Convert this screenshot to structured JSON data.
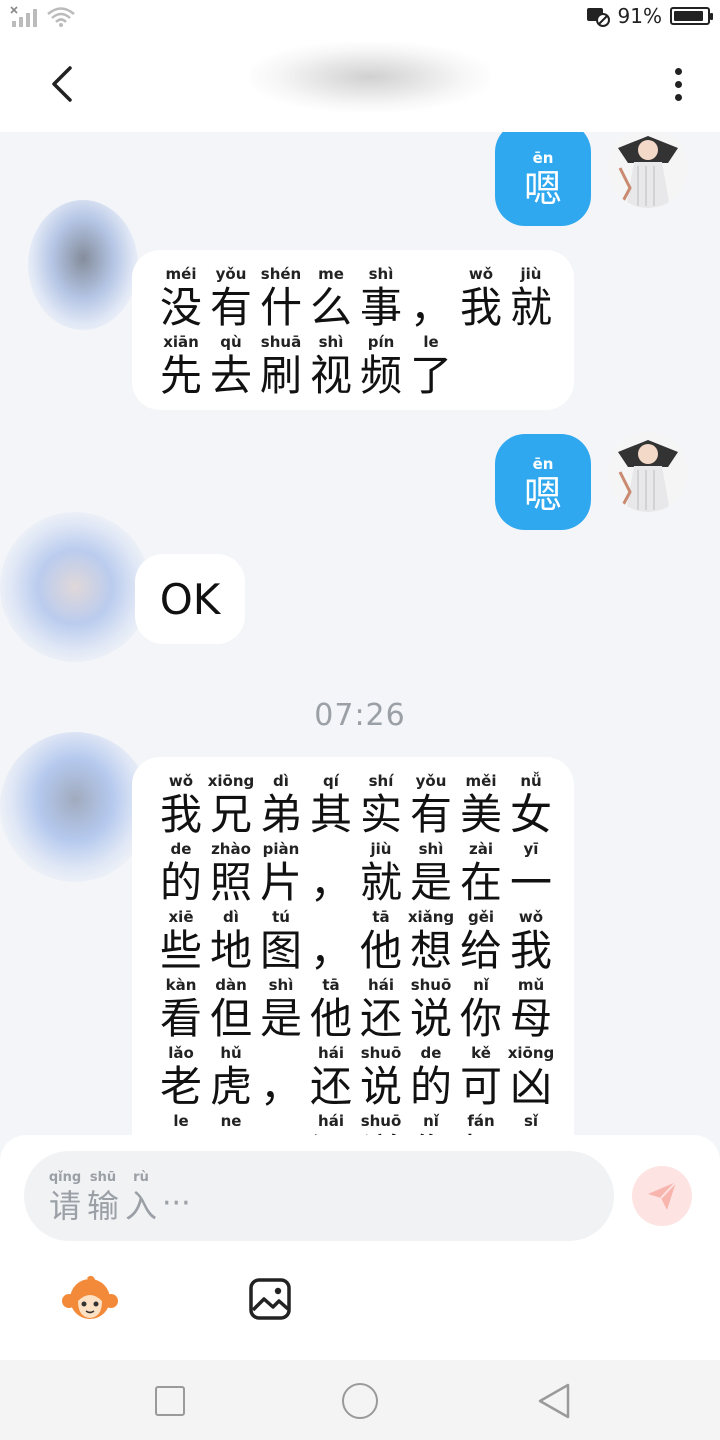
{
  "status_bar": {
    "battery_text": "91%",
    "battery_level": 0.91
  },
  "header": {
    "back_icon": "chevron-left-icon",
    "more_icon": "more-vertical-icon"
  },
  "messages": [
    {
      "id": "m1",
      "side": "right",
      "chars": [
        {
          "py": "ēn",
          "hz": "嗯"
        }
      ]
    },
    {
      "id": "m2",
      "side": "left",
      "lines": [
        [
          {
            "py": "méi",
            "hz": "没"
          },
          {
            "py": "yǒu",
            "hz": "有"
          },
          {
            "py": "shén",
            "hz": "什"
          },
          {
            "py": "me",
            "hz": "么"
          },
          {
            "py": "shì",
            "hz": "事"
          },
          {
            "py": "",
            "hz": "，"
          },
          {
            "py": "wǒ",
            "hz": "我"
          },
          {
            "py": "jiù",
            "hz": "就"
          }
        ],
        [
          {
            "py": "xiān",
            "hz": "先"
          },
          {
            "py": "qù",
            "hz": "去"
          },
          {
            "py": "shuā",
            "hz": "刷"
          },
          {
            "py": "shì",
            "hz": "视"
          },
          {
            "py": "pín",
            "hz": "频"
          },
          {
            "py": "le",
            "hz": "了"
          }
        ]
      ]
    },
    {
      "id": "m3",
      "side": "right",
      "chars": [
        {
          "py": "ēn",
          "hz": "嗯"
        }
      ]
    },
    {
      "id": "m4",
      "side": "left",
      "text": "OK"
    },
    {
      "id": "m5",
      "side": "left",
      "lines": [
        [
          {
            "py": "wǒ",
            "hz": "我"
          },
          {
            "py": "xiōng",
            "hz": "兄"
          },
          {
            "py": "dì",
            "hz": "弟"
          },
          {
            "py": "qí",
            "hz": "其"
          },
          {
            "py": "shí",
            "hz": "实"
          },
          {
            "py": "yǒu",
            "hz": "有"
          },
          {
            "py": "měi",
            "hz": "美"
          },
          {
            "py": "nǚ",
            "hz": "女"
          }
        ],
        [
          {
            "py": "de",
            "hz": "的"
          },
          {
            "py": "zhào",
            "hz": "照"
          },
          {
            "py": "piàn",
            "hz": "片"
          },
          {
            "py": "",
            "hz": "，"
          },
          {
            "py": "jiù",
            "hz": "就"
          },
          {
            "py": "shì",
            "hz": "是"
          },
          {
            "py": "zài",
            "hz": "在"
          },
          {
            "py": "yī",
            "hz": "一"
          }
        ],
        [
          {
            "py": "xiē",
            "hz": "些"
          },
          {
            "py": "dì",
            "hz": "地"
          },
          {
            "py": "tú",
            "hz": "图"
          },
          {
            "py": "",
            "hz": "，"
          },
          {
            "py": "tā",
            "hz": "他"
          },
          {
            "py": "xiǎng",
            "hz": "想"
          },
          {
            "py": "gěi",
            "hz": "给"
          },
          {
            "py": "wǒ",
            "hz": "我"
          }
        ],
        [
          {
            "py": "kàn",
            "hz": "看"
          },
          {
            "py": "dàn",
            "hz": "但"
          },
          {
            "py": "shì",
            "hz": "是"
          },
          {
            "py": "tā",
            "hz": "他"
          },
          {
            "py": "hái",
            "hz": "还"
          },
          {
            "py": "shuō",
            "hz": "说"
          },
          {
            "py": "nǐ",
            "hz": "你"
          },
          {
            "py": "mǔ",
            "hz": "母"
          }
        ],
        [
          {
            "py": "lǎo",
            "hz": "老"
          },
          {
            "py": "hǔ",
            "hz": "虎"
          },
          {
            "py": "",
            "hz": "，"
          },
          {
            "py": "hái",
            "hz": "还"
          },
          {
            "py": "shuō",
            "hz": "说"
          },
          {
            "py": "de",
            "hz": "的"
          },
          {
            "py": "kě",
            "hz": "可"
          },
          {
            "py": "xiōng",
            "hz": "凶"
          }
        ],
        [
          {
            "py": "le",
            "hz": "了"
          },
          {
            "py": "ne",
            "hz": "呢"
          },
          {
            "py": "",
            "hz": "，"
          },
          {
            "py": "hái",
            "hz": "还"
          },
          {
            "py": "shuō",
            "hz": "说"
          },
          {
            "py": "nǐ",
            "hz": "你"
          },
          {
            "py": "fán",
            "hz": "烦"
          },
          {
            "py": "sǐ",
            "hz": "死"
          }
        ]
      ]
    }
  ],
  "timestamp": "07:26",
  "composer": {
    "placeholder_chars": [
      {
        "py": "qǐng",
        "hz": "请"
      },
      {
        "py": "shū",
        "hz": "输"
      },
      {
        "py": "rù",
        "hz": "入"
      }
    ],
    "placeholder_suffix": "···",
    "send_icon": "send-icon",
    "emoji_icon": "monkey-emoji-icon",
    "image_icon": "image-icon"
  },
  "navigation": {
    "recent_icon": "square-icon",
    "home_icon": "circle-icon",
    "back_icon": "triangle-back-icon"
  }
}
